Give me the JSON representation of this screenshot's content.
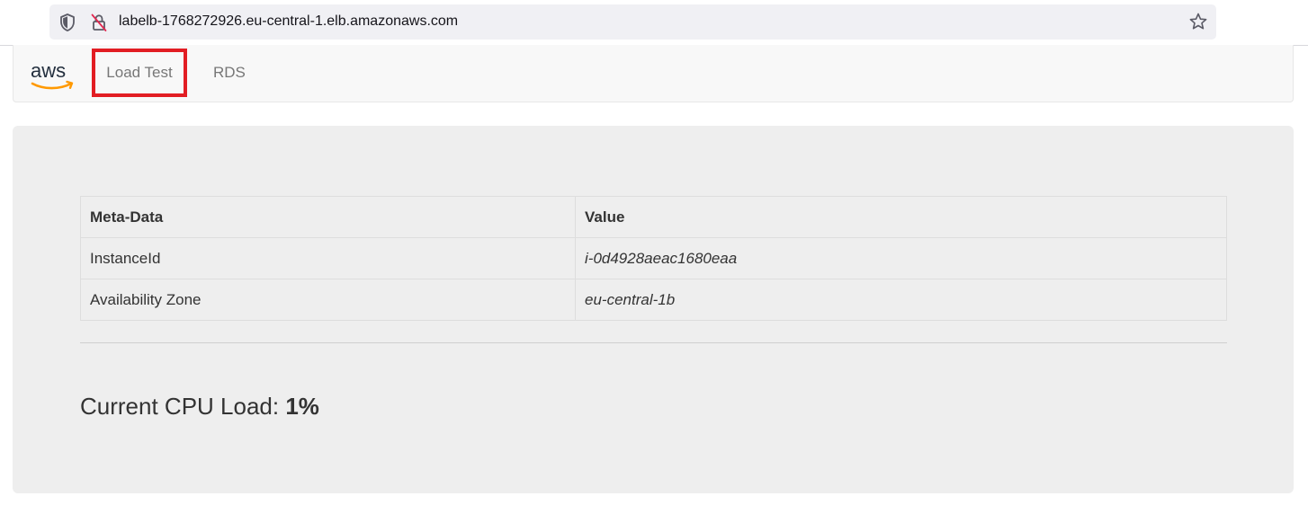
{
  "browser": {
    "url": "labelb-1768272926.eu-central-1.elb.amazonaws.com"
  },
  "navbar": {
    "brand": "aws",
    "items": [
      {
        "label": "Load Test",
        "highlighted": true
      },
      {
        "label": "RDS",
        "highlighted": false
      }
    ],
    "highlight_color": "#e21d23"
  },
  "metadata_table": {
    "headers": [
      "Meta-Data",
      "Value"
    ],
    "rows": [
      {
        "key": "InstanceId",
        "value": "i-0d4928aeac1680eaa"
      },
      {
        "key": "Availability Zone",
        "value": "eu-central-1b"
      }
    ]
  },
  "cpu": {
    "label": "Current CPU Load:",
    "value": "1%"
  },
  "icons": {
    "shield": "shield-icon",
    "lock": "insecure-lock-icon",
    "star": "star-bookmark-icon",
    "brand": "aws-logo-icon"
  }
}
